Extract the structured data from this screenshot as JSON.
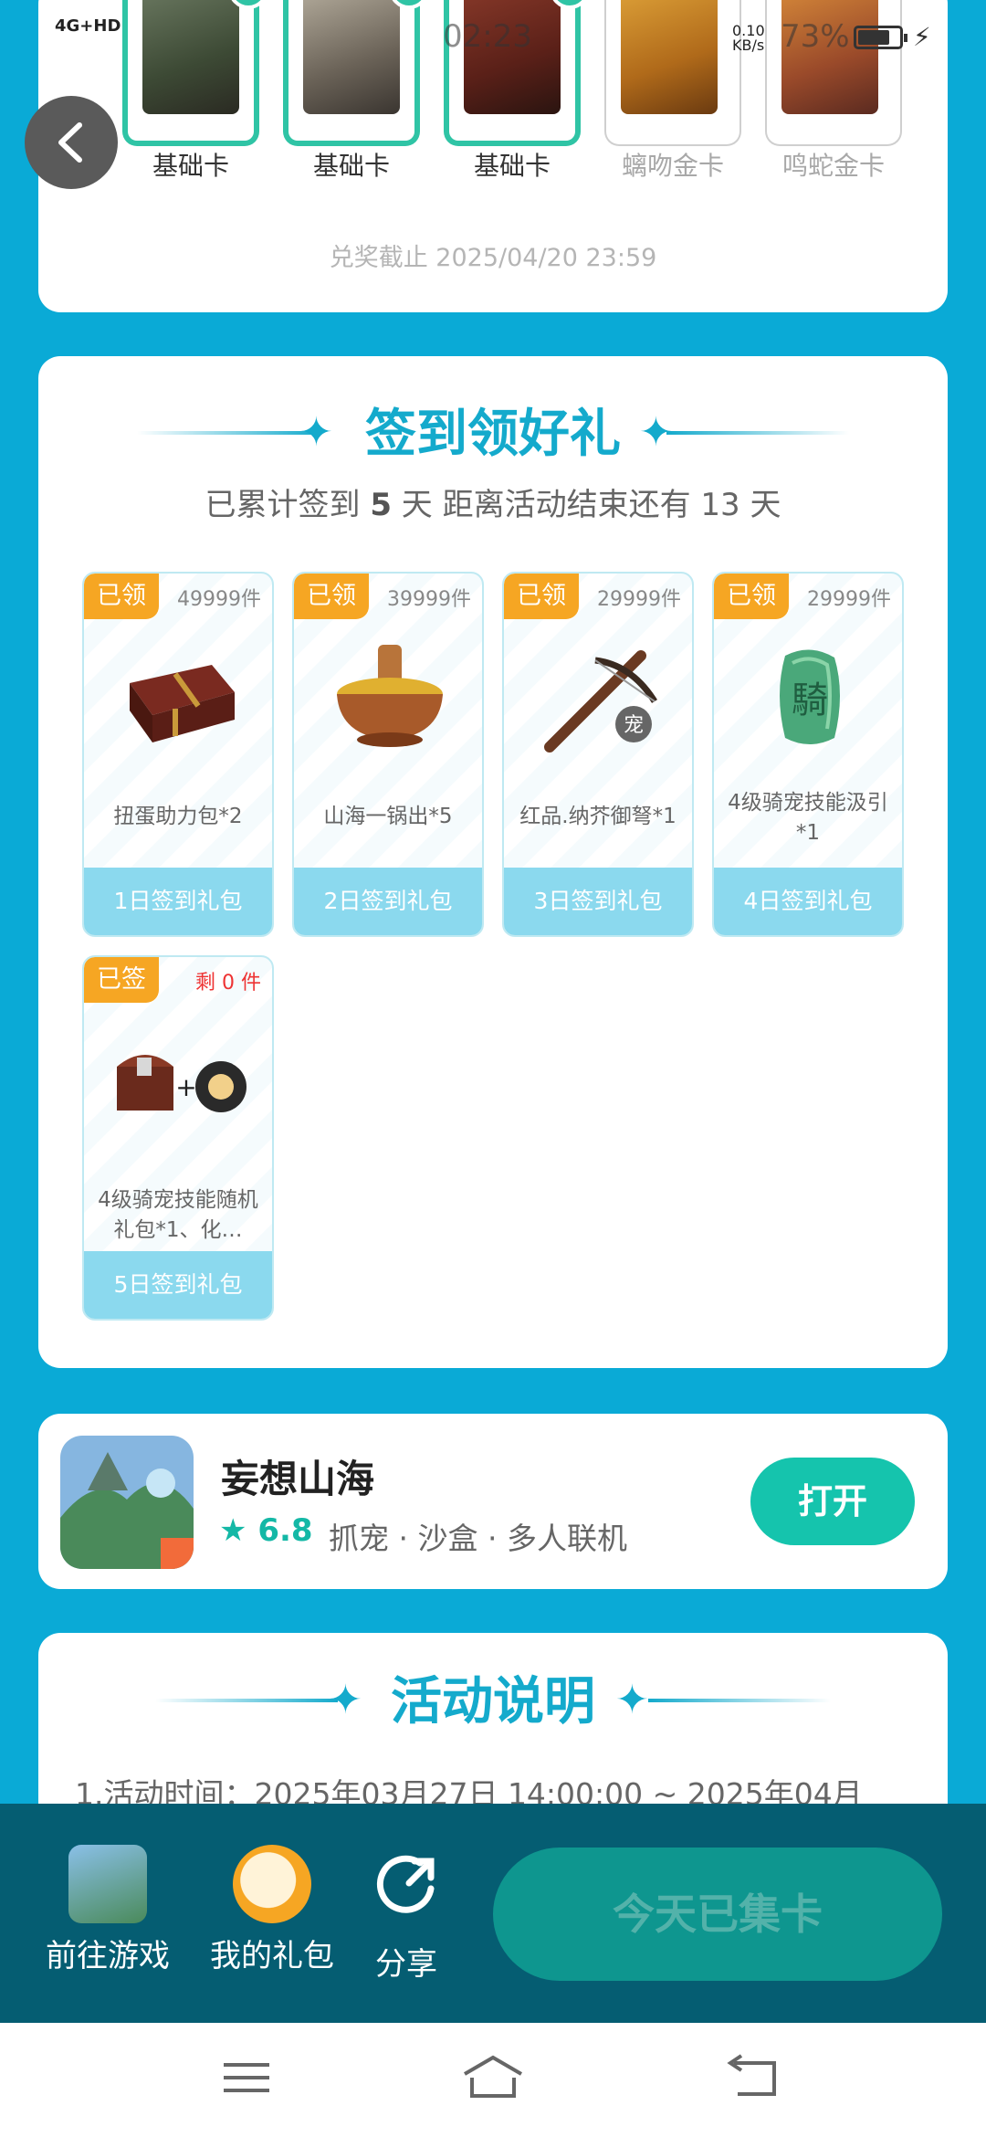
{
  "status_bar": {
    "network": "4G+HD",
    "speed_value": "0.10",
    "speed_unit": "KB/s",
    "time": "02:23",
    "battery": "73%"
  },
  "cards_panel": {
    "cards": [
      {
        "label": "基础卡",
        "collected": true
      },
      {
        "label": "基础卡",
        "collected": true
      },
      {
        "label": "基础卡",
        "collected": true
      },
      {
        "label": "螭吻金卡",
        "collected": false
      },
      {
        "label": "鸣蛇金卡",
        "collected": false
      }
    ],
    "deadline": "兑奖截止 2025/04/20 23:59"
  },
  "signin": {
    "title": "签到领好礼",
    "summary_prefix": "已累计签到",
    "days_signed": "5",
    "summary_middle": "天  距离活动结束还有 13 天",
    "gifts": [
      {
        "tag": "已领",
        "quantity": "49999件",
        "name": "扭蛋助力包*2",
        "footer": "1日签到礼包",
        "icon": "treasure-chest-icon"
      },
      {
        "tag": "已领",
        "quantity": "39999件",
        "name": "山海一锅出*5",
        "footer": "2日签到礼包",
        "icon": "hotpot-icon"
      },
      {
        "tag": "已领",
        "quantity": "29999件",
        "name": "红品.纳芥御弩*1",
        "footer": "3日签到礼包",
        "icon": "crossbow-icon"
      },
      {
        "tag": "已领",
        "quantity": "29999件",
        "name": "4级骑宠技能汲引*1",
        "footer": "4日签到礼包",
        "icon": "jade-seal-icon"
      },
      {
        "tag": "已签",
        "quantity": "剩 0 件",
        "name": "4级骑宠技能随机礼包*1、化…",
        "footer": "5日签到礼包",
        "icon": "chest-and-orb-icon"
      }
    ]
  },
  "app": {
    "name": "妄想山海",
    "rating": "6.8",
    "tags": "抓宠 · 沙盒 · 多人联机",
    "open_label": "打开"
  },
  "rules": {
    "title": "活动说明",
    "first_line": "1.活动时间：2025年03月27日 14:00:00 ~ 2025年04月"
  },
  "action_bar": {
    "goto_game": "前往游戏",
    "my_gifts": "我的礼包",
    "share": "分享",
    "collect_button": "今天已集卡"
  },
  "colors": {
    "background": "#0aaad6",
    "accent": "#14aacc",
    "teal": "#15c4ad",
    "tag_orange": "#f6a623",
    "action_bar": "#055d72"
  }
}
